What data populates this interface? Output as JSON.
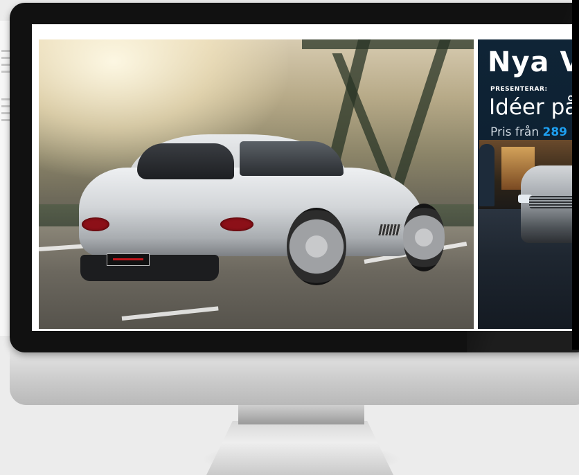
{
  "vw_ad": {
    "headline": "Nya Vo",
    "presents_label": "PRESENTERAR:",
    "ideas_text": "Idéer på",
    "price_prefix": "Pris från",
    "price_value": "289"
  },
  "car_ad": {
    "image_subject": "silver-sports-car-on-bridge"
  },
  "colors": {
    "vw_accent": "#1e9ff0",
    "monitor_bezel": "#111111",
    "vw_background": "#0f2436"
  }
}
